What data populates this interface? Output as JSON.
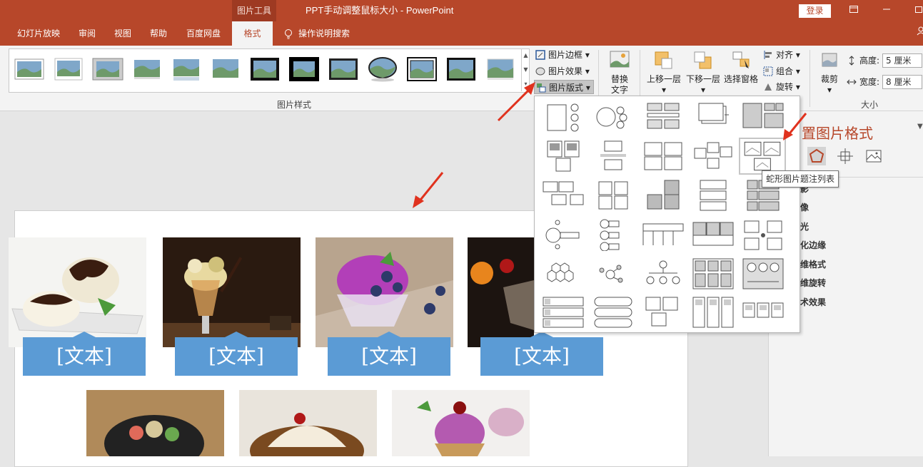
{
  "titlebar": {
    "context_tab": "图片工具",
    "title": "PPT手动调整鼠标大小 - PowerPoint",
    "login": "登录"
  },
  "tabs": [
    {
      "label": "幻灯片放映"
    },
    {
      "label": "审阅"
    },
    {
      "label": "视图"
    },
    {
      "label": "帮助"
    },
    {
      "label": "百度网盘"
    },
    {
      "label": "格式",
      "active": true
    }
  ],
  "tellme": "操作说明搜索",
  "ribbon": {
    "styles_group_label": "图片样式",
    "border_btn": "图片边框",
    "effects_btn": "图片效果",
    "layout_btn": "图片版式",
    "alt_text_line1": "替换",
    "alt_text_line2": "文字",
    "bring_forward": "上移一层",
    "send_backward": "下移一层",
    "selection_pane_line1": "选择窗格",
    "align": "对齐",
    "group": "组合",
    "rotate": "旋转",
    "crop": "裁剪",
    "height_label": "高度:",
    "height_value": "5 厘米",
    "width_label": "宽度:",
    "width_value": "8 厘米",
    "size_group_label": "大小"
  },
  "slide": {
    "captions": [
      "[文本]",
      "[文本]",
      "[文本]",
      "[文本]"
    ]
  },
  "pane": {
    "title": "置图片格式",
    "items": [
      "影",
      "像",
      "光",
      "化边缘",
      "维格式",
      "维旋转",
      "术效果"
    ]
  },
  "layout_menu": {
    "tooltip": "蛇形图片题注列表"
  },
  "colors": {
    "accent": "#b7472a",
    "caption": "#5b9bd5",
    "arrow": "#e0321e"
  }
}
